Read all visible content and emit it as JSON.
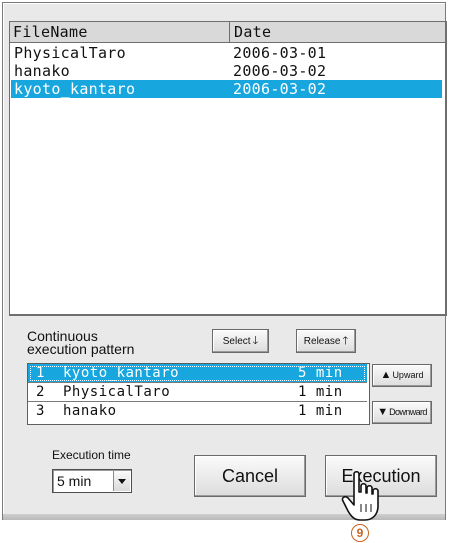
{
  "file_list": {
    "columns": [
      "FileName",
      "Date"
    ],
    "rows": [
      {
        "name": "PhysicalTaro",
        "date": "2006-03-01"
      },
      {
        "name": "hanako",
        "date": "2006-03-02"
      },
      {
        "name": "kyoto_kantaro",
        "date": "2006-03-02",
        "selected": true
      }
    ]
  },
  "continuous": {
    "label_line1": "Continuous",
    "label_line2": "execution pattern",
    "select_label": "Select",
    "release_label": "Release",
    "rows": [
      {
        "index": "1",
        "name": "kyoto_kantaro",
        "time": "5 min",
        "selected": true
      },
      {
        "index": "2",
        "name": "PhysicalTaro",
        "time": "1 min"
      },
      {
        "index": "3",
        "name": "hanako",
        "time": "1 min"
      }
    ],
    "upward_label": "Upward",
    "downward_label": "Downward"
  },
  "execution_time": {
    "label": "Execution time",
    "value": "5 min"
  },
  "buttons": {
    "cancel": "Cancel",
    "execution": "Execution"
  },
  "step_marker": "9",
  "colors": {
    "selection": "#17a6de",
    "marker": "#c8641e"
  }
}
